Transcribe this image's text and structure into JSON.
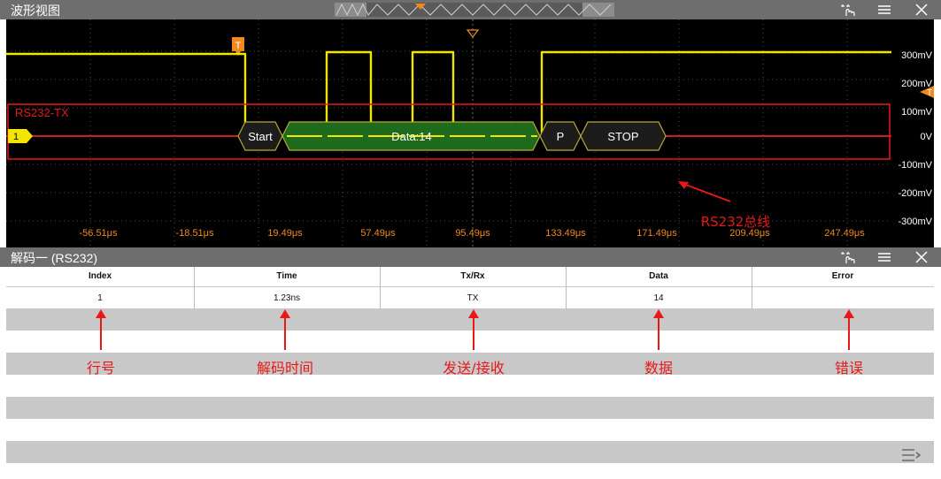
{
  "waveform_window": {
    "title": "波形视图",
    "trigger_marker": "T",
    "level_marker": "T",
    "channel_marker": "1",
    "bus_label": "RS232-TX",
    "bus_frames": [
      "Start",
      "Data:14",
      "P",
      "STOP"
    ],
    "voltage_labels": [
      "300mV",
      "200mV",
      "100mV",
      "0V",
      "-100mV",
      "-200mV",
      "-300mV"
    ],
    "time_labels": [
      "-56.51μs",
      "-18.51μs",
      "19.49μs",
      "57.49μs",
      "95.49μs",
      "133.49μs",
      "171.49μs",
      "209.49μs",
      "247.49μs"
    ],
    "annotation": "RS232总线",
    "icons": [
      "touch-gesture-icon",
      "menu-icon",
      "close-icon"
    ]
  },
  "decode_window": {
    "title": "解码一 (RS232)",
    "columns": [
      "Index",
      "Time",
      "Tx/Rx",
      "Data",
      "Error"
    ],
    "rows": [
      [
        "1",
        "1.23ns",
        "TX",
        "14",
        ""
      ]
    ],
    "annotations": [
      "行号",
      "解码时间",
      "发送/接收",
      "数据",
      "错误"
    ],
    "icons": [
      "touch-gesture-icon",
      "menu-icon",
      "close-icon",
      "collapse-menu-icon"
    ]
  },
  "colors": {
    "channel1": "#f2e600",
    "bus_outline": "#e81818",
    "decode_fill": "#1e6b1e",
    "trigger": "#f08a1c",
    "annotation": "#e81818",
    "title_bar": "#6e6e6e"
  }
}
